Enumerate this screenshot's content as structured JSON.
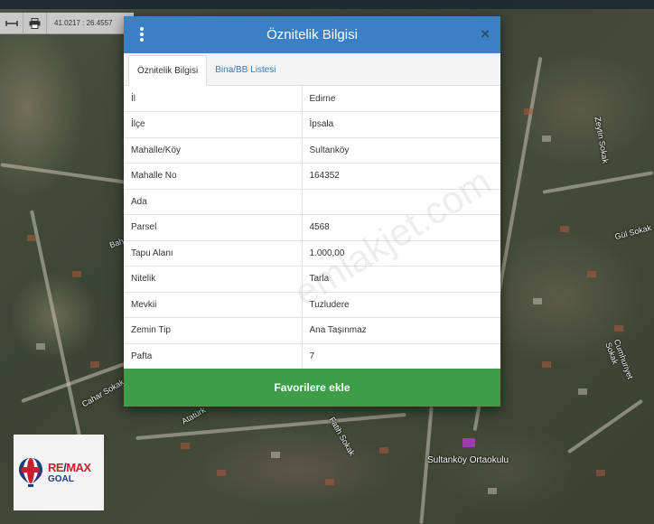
{
  "toolbar": {
    "measure_icon": "measure-icon",
    "print_icon": "print-icon",
    "coordinates": "41.0217 : 26.4557"
  },
  "map": {
    "labels": {
      "bahar_sokak": "Bahar Sokak",
      "cahar_sokak": "Cahar Sokak",
      "gulsokak": "Gül Sokak",
      "sultankoy_ortaokulu": "Sultanköy Ortaokulu",
      "fatih_sokak": "Fatih Sokak",
      "ataturk": "Atatürk",
      "cumhuriyet": "Cumhuriyet Sokak",
      "zeytin": "Zeytin Sokak"
    }
  },
  "modal": {
    "title": "Öznitelik Bilgisi",
    "close_label": "×",
    "tabs": [
      {
        "label": "Öznitelik Bilgisi",
        "active": true
      },
      {
        "label": "Bina/BB Listesi",
        "active": false
      }
    ],
    "rows": [
      {
        "key": "İl",
        "value": "Edirne"
      },
      {
        "key": "İlçe",
        "value": "İpsala"
      },
      {
        "key": "Mahalle/Köy",
        "value": "Sultanköy"
      },
      {
        "key": "Mahalle No",
        "value": "164352"
      },
      {
        "key": "Ada",
        "value": ""
      },
      {
        "key": "Parsel",
        "value": "4568"
      },
      {
        "key": "Tapu Alanı",
        "value": "1.000,00"
      },
      {
        "key": "Nitelik",
        "value": "Tarla"
      },
      {
        "key": "Mevkii",
        "value": "Tuzludere"
      },
      {
        "key": "Zemin Tip",
        "value": "Ana Taşınmaz"
      },
      {
        "key": "Pafta",
        "value": "7"
      }
    ],
    "favorite_button": "Favorilere ekle"
  },
  "watermark": "emlakjet.com",
  "logo": {
    "brand_left": "RE",
    "brand_slash": "/",
    "brand_right": "MAX",
    "sub": "GOAL"
  },
  "colors": {
    "header_blue": "#3b80c4",
    "button_green": "#3e9e48",
    "remax_red": "#cc1f2d",
    "remax_blue": "#1d3d7a"
  }
}
